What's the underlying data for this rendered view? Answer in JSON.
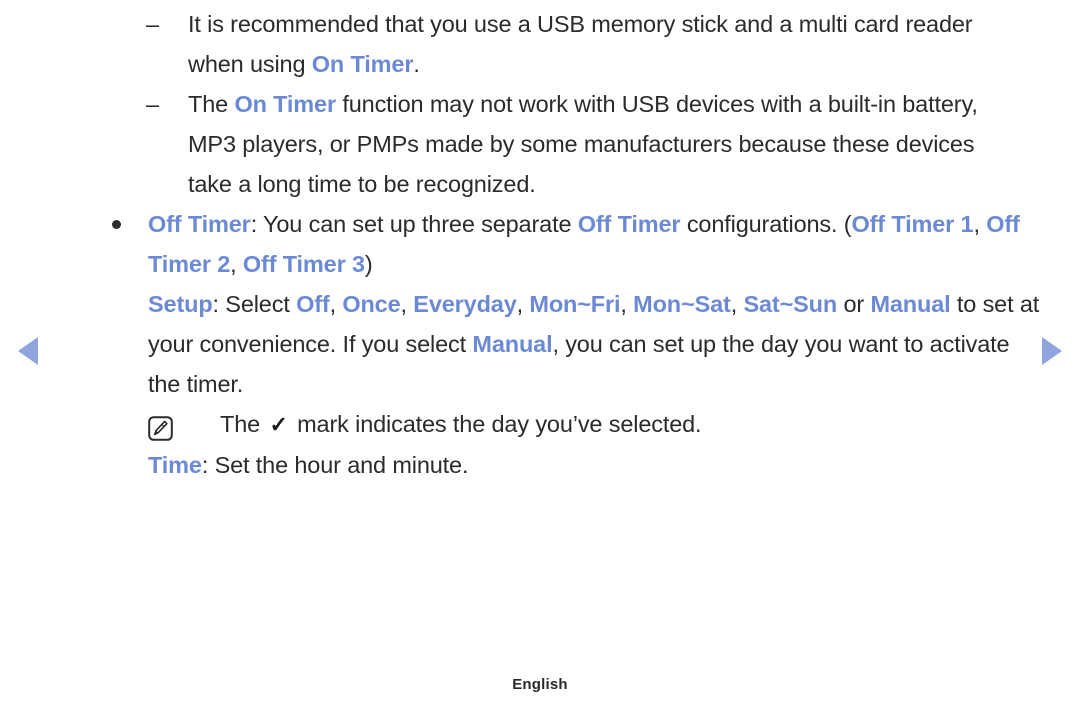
{
  "page": {
    "language_footer": "English",
    "accent_color": "#6c8ad4",
    "body_color": "#2b2b2b",
    "arrow_color": "#8fa5dd",
    "background": "#ffffff"
  },
  "nav": {
    "prev_label": "Previous page",
    "prev_icon": "triangle-left-icon",
    "next_label": "Next page",
    "next_icon": "triangle-right-icon"
  },
  "content": {
    "notes": [
      {
        "marker": "–",
        "segments": [
          {
            "text": "It is recommended that you use a USB memory stick and a multi card reader when using ",
            "kw": false
          },
          {
            "text": "On Timer",
            "kw": true
          },
          {
            "text": ".",
            "kw": false
          }
        ]
      },
      {
        "marker": "–",
        "segments": [
          {
            "text": "The ",
            "kw": false
          },
          {
            "text": "On Timer",
            "kw": true
          },
          {
            "text": " function may not work with USB devices with a built-in battery, MP3 players, or PMPs made by some manufacturers because these devices take a long time to be recognized.",
            "kw": false
          }
        ]
      }
    ],
    "bullet": {
      "marker": "●",
      "segments": [
        {
          "text": "Off Timer",
          "kw": true
        },
        {
          "text": ": You can set up three separate ",
          "kw": false
        },
        {
          "text": "Off Timer",
          "kw": true
        },
        {
          "text": " configurations. (",
          "kw": false
        },
        {
          "text": "Off Timer 1",
          "kw": true
        },
        {
          "text": ", ",
          "kw": false
        },
        {
          "text": "Off Timer 2",
          "kw": true
        },
        {
          "text": ", ",
          "kw": false
        },
        {
          "text": "Off Timer 3",
          "kw": true
        },
        {
          "text": ")",
          "kw": false
        }
      ]
    },
    "setup_paragraph": {
      "segments": [
        {
          "text": "Setup",
          "kw": true
        },
        {
          "text": ": Select ",
          "kw": false
        },
        {
          "text": "Off",
          "kw": true
        },
        {
          "text": ", ",
          "kw": false
        },
        {
          "text": "Once",
          "kw": true
        },
        {
          "text": ", ",
          "kw": false
        },
        {
          "text": "Everyday",
          "kw": true
        },
        {
          "text": ", ",
          "kw": false
        },
        {
          "text": "Mon~Fri",
          "kw": true
        },
        {
          "text": ", ",
          "kw": false
        },
        {
          "text": "Mon~Sat",
          "kw": true
        },
        {
          "text": ", ",
          "kw": false
        },
        {
          "text": "Sat~Sun",
          "kw": true
        },
        {
          "text": " or ",
          "kw": false
        },
        {
          "text": "Manual",
          "kw": true
        },
        {
          "text": " to set at your convenience. If you select ",
          "kw": false
        },
        {
          "text": "Manual",
          "kw": true
        },
        {
          "text": ", you can set up the day you want to activate the timer.",
          "kw": false
        }
      ]
    },
    "note_row": {
      "icon": "note-pencil-icon",
      "prefix": "The",
      "check_glyph": "✓",
      "suffix": "mark indicates the day you’ve selected."
    },
    "time_paragraph": {
      "segments": [
        {
          "text": "Time",
          "kw": true
        },
        {
          "text": ": Set the hour and minute.",
          "kw": false
        }
      ]
    }
  }
}
